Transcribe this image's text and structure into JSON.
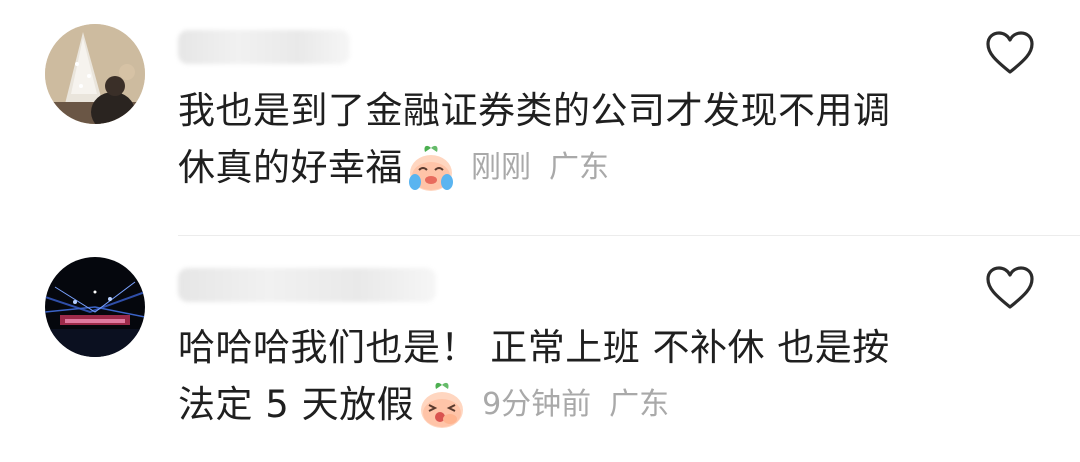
{
  "comments": [
    {
      "line1": "我也是到了金融证券类的公司才发现不用调",
      "line2": "休真的好幸福",
      "emoji": "crying-peach-emoji",
      "time": "刚刚",
      "location": "广东",
      "like_icon": "heart-outline-icon"
    },
    {
      "line1": "哈哈哈我们也是！ 正常上班 不补休 也是按",
      "line2": "法定 5 天放假",
      "emoji": "laughing-peach-emoji",
      "time": "9分钟前",
      "location": "广东",
      "like_icon": "heart-outline-icon"
    }
  ],
  "colors": {
    "text": "#1f1f1f",
    "meta": "#a9a9a9",
    "divider": "#ececec",
    "heart_stroke": "#2b2b2b"
  }
}
